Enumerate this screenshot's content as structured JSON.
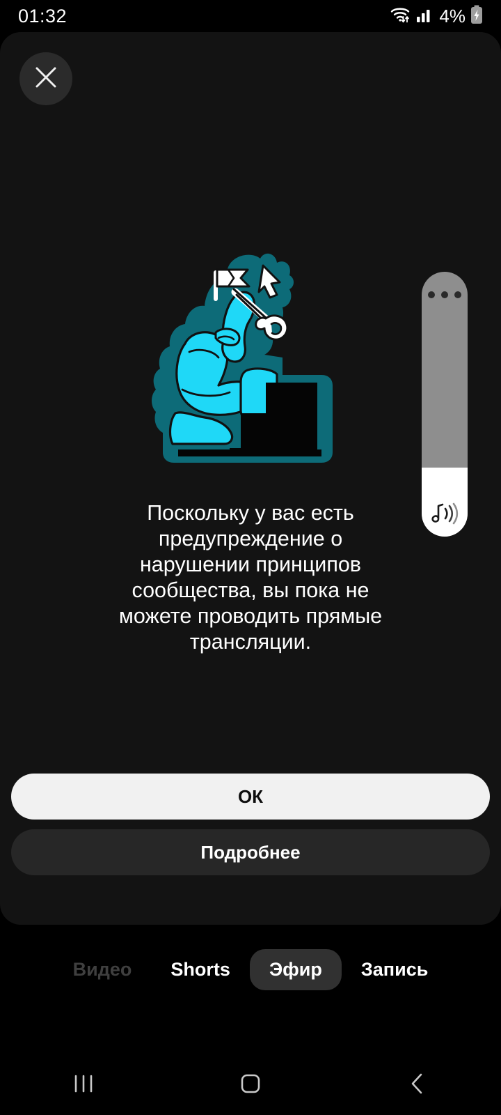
{
  "statusbar": {
    "clock": "01:32",
    "battery_text": "4%",
    "wifi_icon": "wifi-updown-icon",
    "signal_icon": "signal-bars-icon",
    "battery_icon": "battery-charging-icon"
  },
  "dialog": {
    "close_icon": "close-icon",
    "illustration_name": "thinking-person-with-key-illustration",
    "message": "Поскольку у вас есть предупреждение о нарушении принципов сообщества, вы пока не можете проводить прямые трансляции.",
    "primary_button": "ОК",
    "secondary_button": "Подробнее"
  },
  "tabs": [
    {
      "label": "Видео",
      "state": "dim"
    },
    {
      "label": "Shorts",
      "state": "normal"
    },
    {
      "label": "Эфир",
      "state": "active"
    },
    {
      "label": "Запись",
      "state": "normal"
    }
  ],
  "volume_slider": {
    "menu_icon": "more-dots-icon",
    "sound_icon": "music-note-sound-icon",
    "level_percent": 26
  },
  "navbar": {
    "recents_icon": "recents-icon",
    "home_icon": "home-icon",
    "back_icon": "back-chevron-icon"
  },
  "colors": {
    "background": "#000000",
    "panel": "#131313",
    "illustration_cyan": "#1FD8F7",
    "illustration_teal": "#0D6B78",
    "primary_button_bg": "#f1f1f1",
    "secondary_button_bg": "#272727",
    "active_tab_bg": "#313131",
    "text": "#ffffff"
  }
}
